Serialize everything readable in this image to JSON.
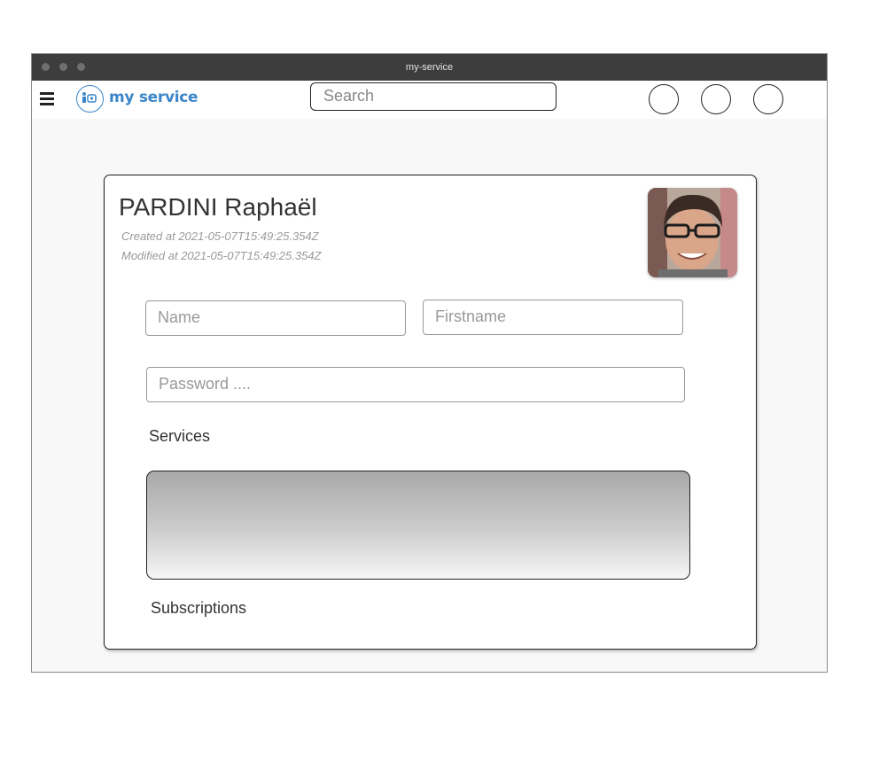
{
  "window": {
    "title": "my-service"
  },
  "appbar": {
    "menu_icon": "hamburger-icon",
    "logo_text": "my service",
    "search_placeholder": "Search",
    "action_buttons": [
      "circle-button",
      "circle-button",
      "circle-button"
    ]
  },
  "profile": {
    "full_name": "PARDINI Raphaël",
    "created": "Created at 2021-05-07T15:49:25.354Z",
    "modified": "Modified at 2021-05-07T15:49:25.354Z",
    "name_placeholder": "Name",
    "firstname_placeholder": "Firstname",
    "password_placeholder": "Password ....",
    "services_label": "Services",
    "subscriptions_label": "Subscriptions"
  },
  "colors": {
    "brand": "#3a86c8",
    "titlebar": "#3d3d3d"
  }
}
